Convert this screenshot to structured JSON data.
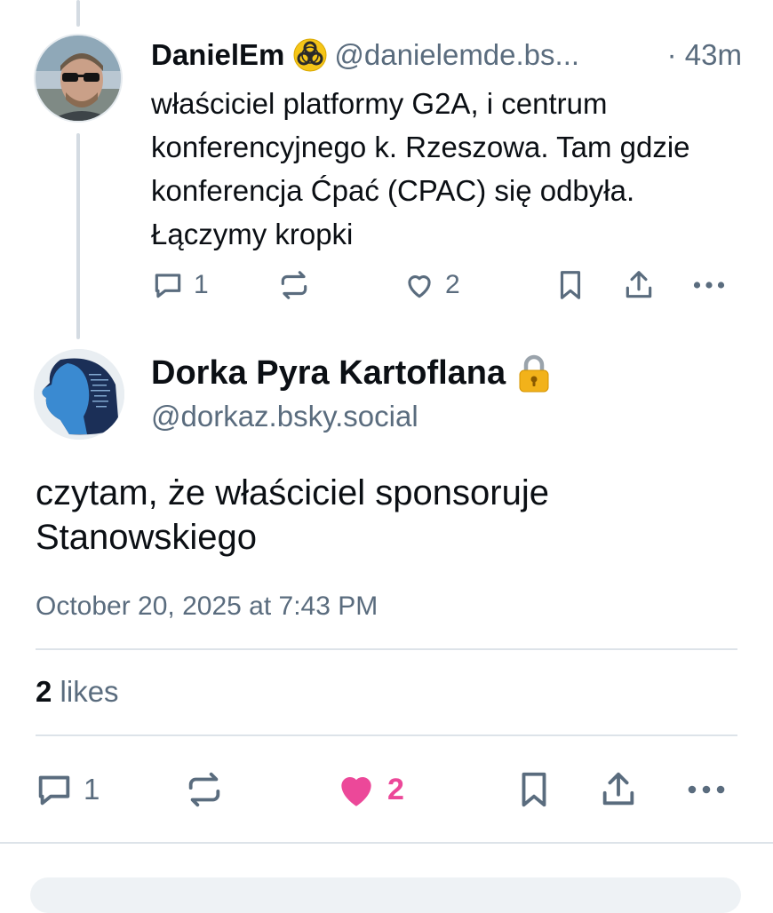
{
  "reply": {
    "display_name": "DanielEm",
    "emoji_icon": "biohazard-icon",
    "handle": "@danielemde.bs...",
    "time": "· 43m",
    "text": "właściciel platformy G2A, i centrum konferencyjnego k. Rzeszowa. Tam gdzie konferencja Ćpać (CPAC) się odbyła. Łączymy kropki",
    "actions": {
      "reply_count": "1",
      "like_count": "2"
    }
  },
  "post": {
    "display_name": "Dorka Pyra Kartoflana",
    "lock_icon": "lock-icon",
    "handle": "@dorkaz.bsky.social",
    "text": "czytam, że właściciel sponsoruje Stanowskiego",
    "timestamp": "October 20, 2025 at 7:43 PM",
    "likes_count": "2",
    "likes_label": "likes",
    "actions": {
      "reply_count": "1",
      "like_count": "2"
    }
  },
  "colors": {
    "text": "#0b0f14",
    "muted": "#5a6c7e",
    "like_active": "#ec4899",
    "thread_line": "#d4dbe2",
    "divider": "#dde3e9"
  }
}
